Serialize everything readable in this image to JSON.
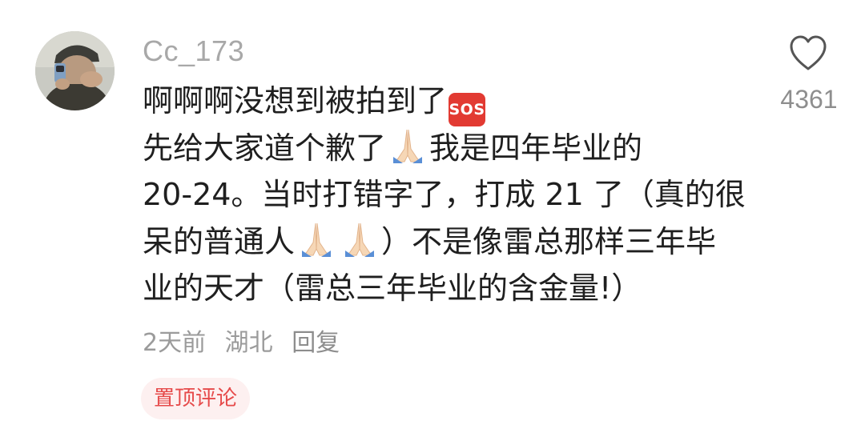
{
  "comment": {
    "username": "Cc_173",
    "lines": [
      "啊啊啊没想到被拍到了",
      "先给大家道个歉了",
      "我是四年毕业的",
      "20-24。当时打错字了，打成 21 了（真的很",
      "呆的普通人",
      "）不是像雷总那样三年毕",
      "业的天才（雷总三年毕业的含金量!）"
    ],
    "emoji": {
      "sos": "SOS",
      "pray_icon": "folded-hands-icon"
    },
    "meta": {
      "time": "2天前",
      "location": "湖北",
      "reply": "回复"
    },
    "pinned_label": "置顶评论"
  },
  "like": {
    "icon": "heart-icon",
    "count": "4361"
  },
  "colors": {
    "username": "#a8a8a8",
    "body_text": "#1f1f1f",
    "meta": "#9b9b9b",
    "pinned_bg": "#fdf0f0",
    "pinned_text": "#e64a4a",
    "sos_red": "#e23a32"
  }
}
